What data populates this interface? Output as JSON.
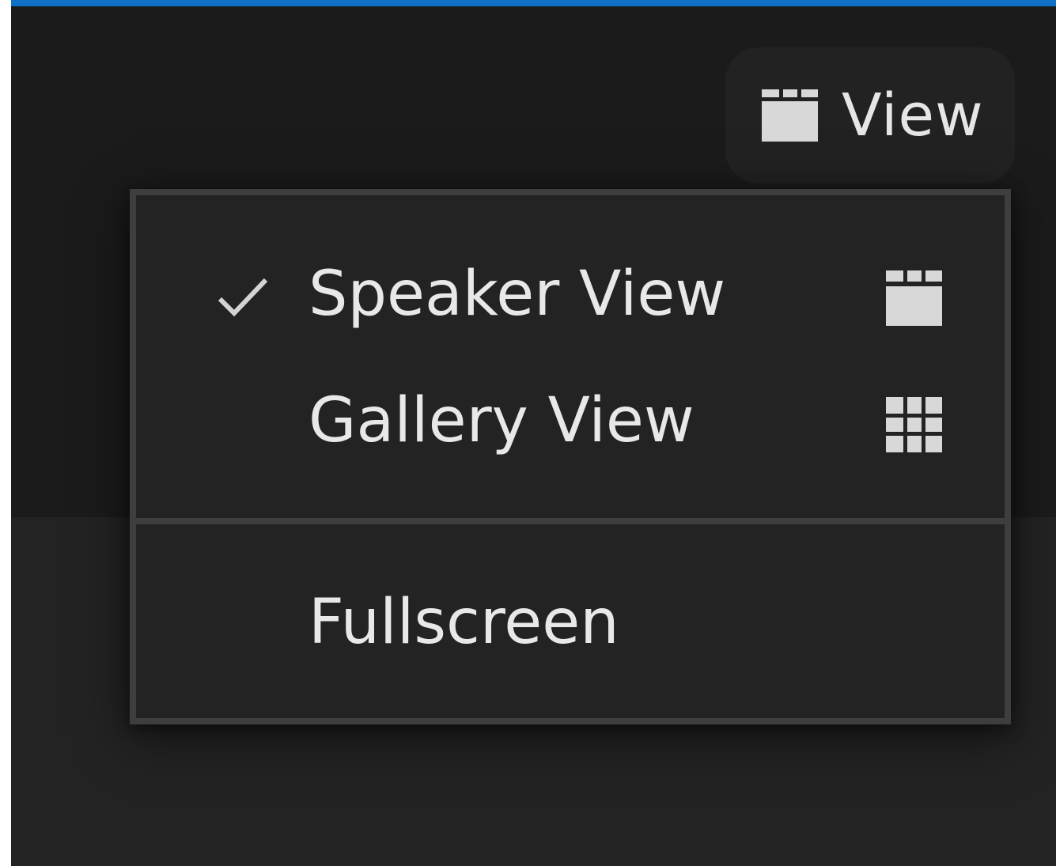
{
  "toolbar": {
    "view_button_label": "View",
    "view_button_icon": "speaker-view-icon"
  },
  "view_menu": {
    "items": [
      {
        "label": "Speaker View",
        "checked": true,
        "icon": "speaker-view-icon"
      },
      {
        "label": "Gallery View",
        "checked": false,
        "icon": "gallery-view-icon"
      },
      {
        "label": "Fullscreen",
        "checked": false
      }
    ]
  },
  "colors": {
    "accent": "#0e71c6",
    "background": "#232323",
    "top_bar": "#1b1b1b",
    "menu_border": "#3e3e3e",
    "text": "#e8e8e8"
  }
}
